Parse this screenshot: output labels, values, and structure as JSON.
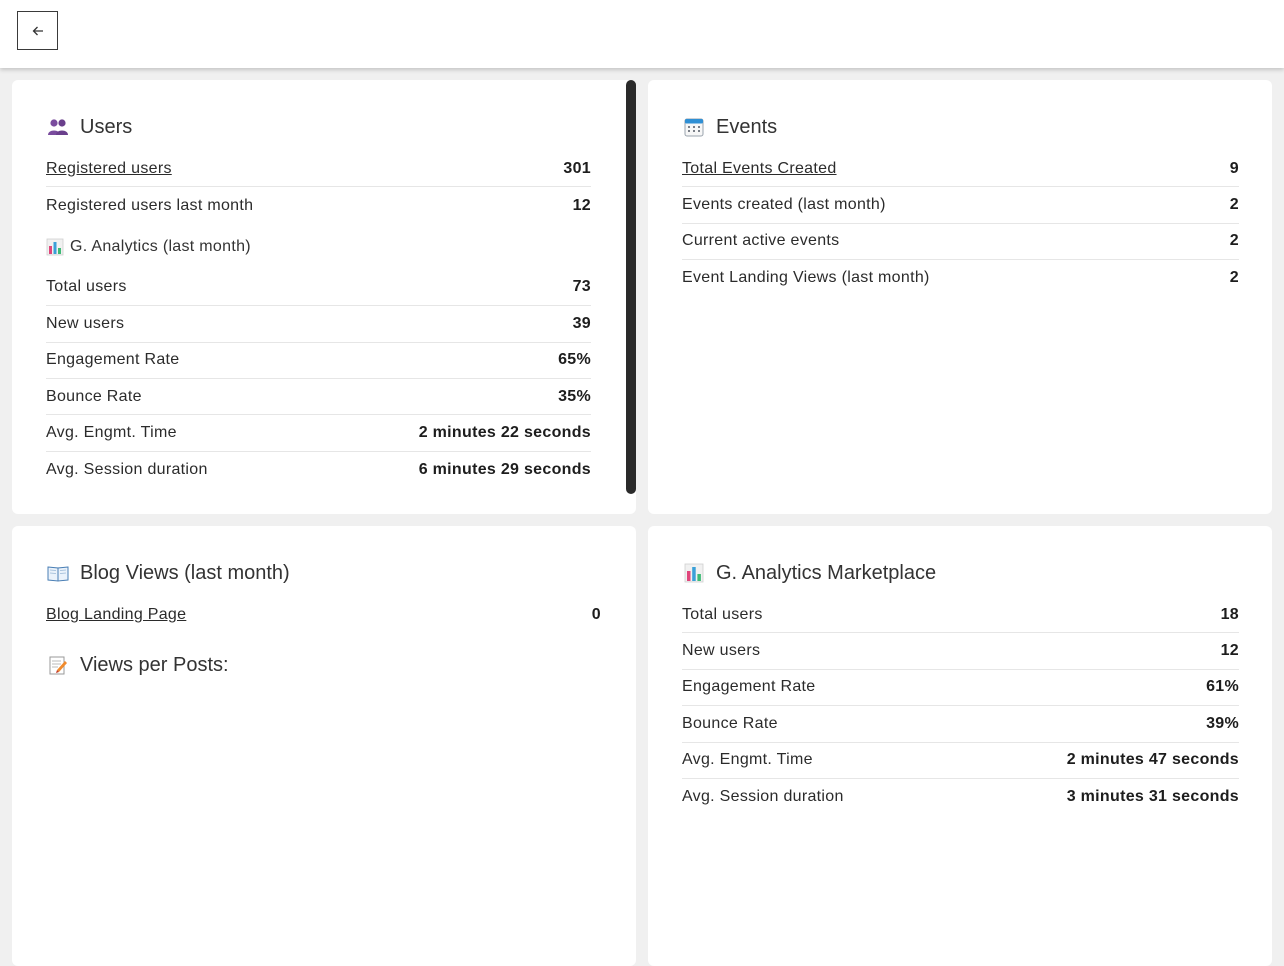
{
  "toolbar": {
    "back_icon": "arrow-left-icon"
  },
  "users": {
    "title": "Users",
    "icon": "users-icon",
    "rows": [
      {
        "label": "Registered users",
        "value": "301"
      },
      {
        "label": "Registered users last month",
        "value": "12"
      }
    ],
    "analytics_title": "G. Analytics (last month)",
    "analytics_icon": "bar-chart-icon",
    "analytics_rows": [
      {
        "label": "Total users",
        "value": "73"
      },
      {
        "label": "New users",
        "value": "39"
      },
      {
        "label": "Engagement Rate",
        "value": "65%"
      },
      {
        "label": "Bounce Rate",
        "value": "35%"
      },
      {
        "label": "Avg. Engmt. Time",
        "value": "2 minutes 22 seconds"
      },
      {
        "label": "Avg. Session duration",
        "value": "6 minutes 29 seconds"
      }
    ]
  },
  "events": {
    "title": "Events",
    "icon": "calendar-icon",
    "rows": [
      {
        "label": "Total Events Created",
        "value": "9"
      },
      {
        "label": "Events created (last month)",
        "value": "2"
      },
      {
        "label": "Current active events",
        "value": "2"
      },
      {
        "label": "Event Landing Views (last month)",
        "value": "2"
      }
    ]
  },
  "blog": {
    "title": "Blog Views (last month)",
    "icon": "book-icon",
    "rows": [
      {
        "label": "Blog Landing Page",
        "value": "0"
      }
    ],
    "posts_title": "Views per Posts:",
    "posts_icon": "memo-icon"
  },
  "marketplace": {
    "title": "G. Analytics Marketplace",
    "icon": "bar-chart-icon",
    "rows": [
      {
        "label": "Total users",
        "value": "18"
      },
      {
        "label": "New users",
        "value": "12"
      },
      {
        "label": "Engagement Rate",
        "value": "61%"
      },
      {
        "label": "Bounce Rate",
        "value": "39%"
      },
      {
        "label": "Avg. Engmt. Time",
        "value": "2 minutes 47 seconds"
      },
      {
        "label": "Avg. Session duration",
        "value": "3 minutes 31 seconds"
      }
    ]
  }
}
